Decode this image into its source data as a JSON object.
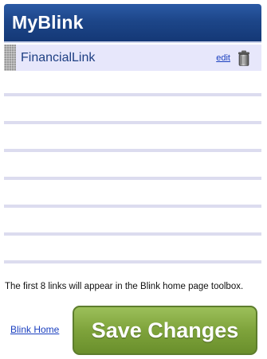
{
  "header": {
    "title": "MyBlink"
  },
  "links": [
    {
      "label": "FinancialLink",
      "edit_label": "edit",
      "icon": "trash-can-icon"
    }
  ],
  "empty_slots": 7,
  "footer": {
    "note": "The first 8 links will appear in the Blink home page toolbox.",
    "home_link": "Blink Home",
    "save_button": "Save Changes"
  },
  "colors": {
    "header": "#1d4689",
    "row_fill": "#e7e7fb",
    "link_text": "#1e3f83",
    "save_button": "#7ea33b"
  }
}
